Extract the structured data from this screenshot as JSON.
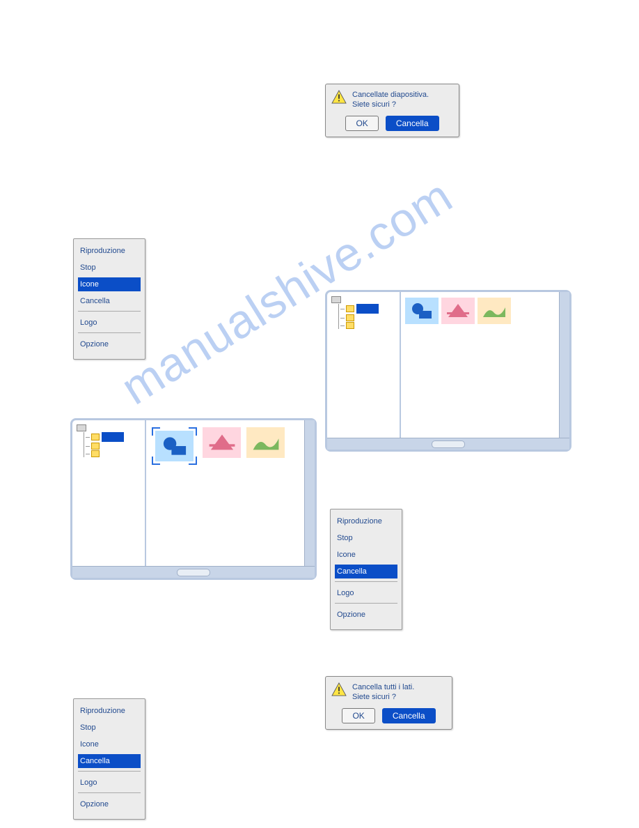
{
  "dialog1": {
    "line1": "Cancellate diapositiva.",
    "line2": "Siete sicuri ?",
    "ok": "OK",
    "cancel": "Cancella"
  },
  "dialog2": {
    "line1": "Cancella tutti i lati.",
    "line2": "Siete sicuri ?",
    "ok": "OK",
    "cancel": "Cancella"
  },
  "menu": {
    "item0": "Riproduzione",
    "item1": "Stop",
    "item2": "Icone",
    "item3": "Cancella",
    "item4": "Logo",
    "item5": "Opzione"
  },
  "watermark": "manualshive.com"
}
